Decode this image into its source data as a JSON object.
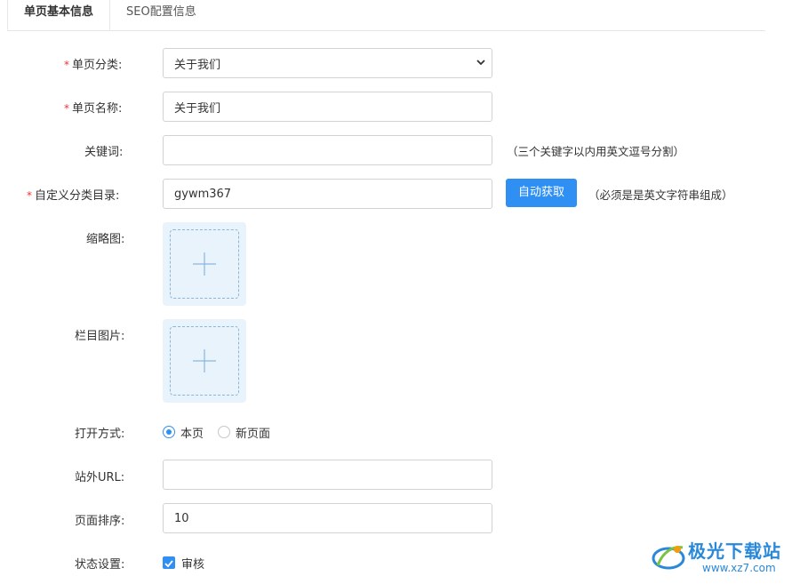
{
  "tabs": [
    {
      "label": "单页基本信息"
    },
    {
      "label": "SEO配置信息"
    }
  ],
  "form": {
    "category": {
      "label": "单页分类:",
      "value": "关于我们"
    },
    "name": {
      "label": "单页名称:",
      "value": "关于我们"
    },
    "keywords": {
      "label": "关键词:",
      "value": "",
      "hint": "（三个关键字以内用英文逗号分割）"
    },
    "custom_dir": {
      "label": "自定义分类目录:",
      "value": "gywm367",
      "button": "自动获取",
      "hint": "（必须是是英文字符串组成）"
    },
    "thumbnail": {
      "label": "缩略图:"
    },
    "column_image": {
      "label": "栏目图片:"
    },
    "open_mode": {
      "label": "打开方式:",
      "options": [
        "本页",
        "新页面"
      ],
      "selected": "本页"
    },
    "external_url": {
      "label": "站外URL:",
      "value": ""
    },
    "sort": {
      "label": "页面排序:",
      "value": "10"
    },
    "status": {
      "label": "状态设置:",
      "option": "审核",
      "checked": true
    }
  },
  "required_mark": "*",
  "watermark": {
    "text": "极光下载站",
    "url": "www.xz7.com"
  }
}
